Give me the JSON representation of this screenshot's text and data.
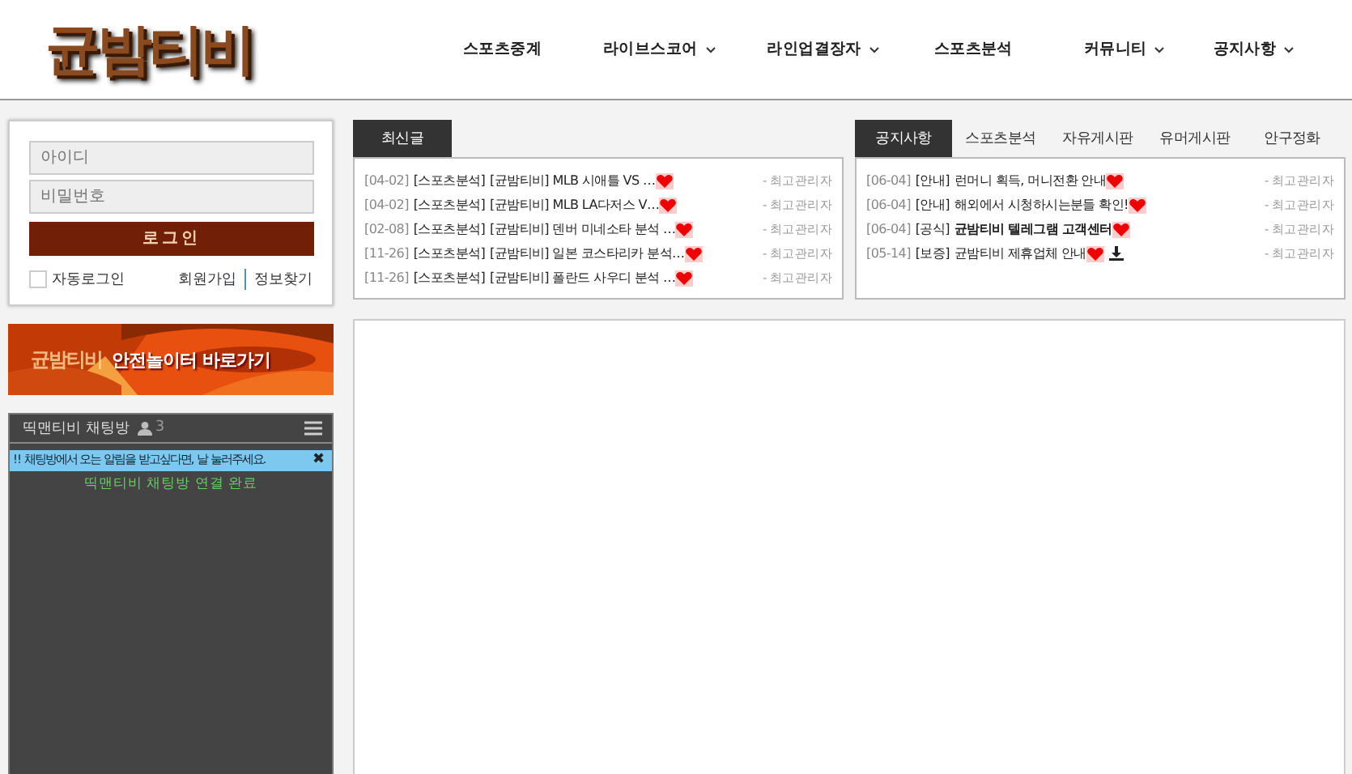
{
  "logo": {
    "text": "균밤티비"
  },
  "nav": [
    {
      "label": "스포츠중계",
      "dropdown": false
    },
    {
      "label": "라이브스코어",
      "dropdown": true
    },
    {
      "label": "라인업결장자",
      "dropdown": true
    },
    {
      "label": "스포츠분석",
      "dropdown": false
    },
    {
      "label": "커뮤니티",
      "dropdown": true
    },
    {
      "label": "공지사항",
      "dropdown": true
    }
  ],
  "login": {
    "id_placeholder": "아이디",
    "pw_placeholder": "비밀번호",
    "button": "로그인",
    "auto_login": {
      "label": "자동로그인",
      "checked": false
    },
    "links": [
      "회원가입",
      "정보찾기"
    ]
  },
  "banner": {
    "logo_text": "균밤티비",
    "text": "안전놀이터 바로가기"
  },
  "chat": {
    "title": "띡맨티비 채팅방",
    "users": "3",
    "notice": "!! 채팅방에서 오는 알림을 받고싶다면, 날 눌러주세요.",
    "close": "✖",
    "status": "띡맨티비 채팅방 연결 완료"
  },
  "boards": [
    {
      "tabs": [
        {
          "label": "최신글",
          "selected": true
        }
      ],
      "posts": [
        {
          "date": "[04-02]",
          "category": "[스포츠분석]",
          "title": "[균밤티비] MLB 시애틀 VS …",
          "hot": true,
          "bold": false,
          "attachment": false,
          "author": "- 최고관리자"
        },
        {
          "date": "[04-02]",
          "category": "[스포츠분석]",
          "title": "[균밤티비] MLB LA다저스 V…",
          "hot": true,
          "bold": false,
          "attachment": false,
          "author": "- 최고관리자"
        },
        {
          "date": "[02-08]",
          "category": "[스포츠분석]",
          "title": "[균밤티비] 덴버 미네소타 분석 …",
          "hot": true,
          "bold": false,
          "attachment": false,
          "author": "- 최고관리자"
        },
        {
          "date": "[11-26]",
          "category": "[스포츠분석]",
          "title": "[균밤티비] 일본 코스타리카 분석…",
          "hot": true,
          "bold": false,
          "attachment": false,
          "author": "- 최고관리자"
        },
        {
          "date": "[11-26]",
          "category": "[스포츠분석]",
          "title": "[균밤티비] 폴란드 사우디 분석 …",
          "hot": true,
          "bold": false,
          "attachment": false,
          "author": "- 최고관리자"
        }
      ]
    },
    {
      "tabs": [
        {
          "label": "공지사항",
          "selected": true
        },
        {
          "label": "스포츠분석",
          "selected": false
        },
        {
          "label": "자유게시판",
          "selected": false
        },
        {
          "label": "유머게시판",
          "selected": false
        },
        {
          "label": "안구정화",
          "selected": false
        }
      ],
      "posts": [
        {
          "date": "[06-04]",
          "category": "[안내]",
          "title": "런머니 획득, 머니전환 안내",
          "hot": true,
          "bold": false,
          "attachment": false,
          "author": "- 최고관리자"
        },
        {
          "date": "[06-04]",
          "category": "[안내]",
          "title": "해외에서 시청하시는분들 확인!",
          "hot": true,
          "bold": false,
          "attachment": false,
          "author": "- 최고관리자"
        },
        {
          "date": "[06-04]",
          "category": "[공식]",
          "title": "균밤티비 텔레그램 고객센터",
          "hot": true,
          "bold": true,
          "attachment": false,
          "author": "- 최고관리자"
        },
        {
          "date": "[05-14]",
          "category": "[보증]",
          "title": "균밤티비 제휴업체 안내",
          "hot": true,
          "bold": false,
          "attachment": true,
          "author": "- 최고관리자"
        }
      ]
    }
  ]
}
